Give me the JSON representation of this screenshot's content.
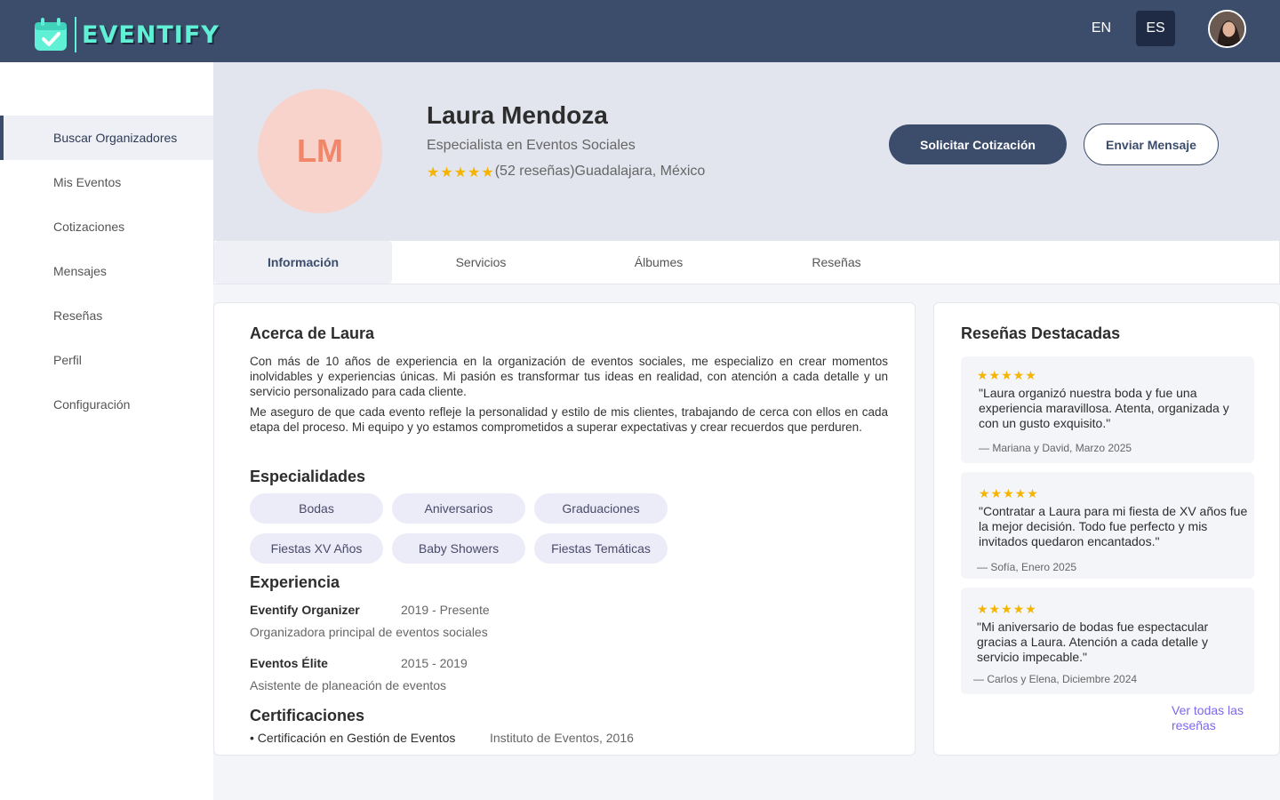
{
  "header": {
    "brand": "EVENTIFY",
    "lang_en": "EN",
    "lang_es": "ES",
    "active_lang": "ES"
  },
  "sidebar": {
    "items": [
      {
        "label": "Buscar Organizadores",
        "active": true
      },
      {
        "label": "Mis Eventos"
      },
      {
        "label": "Cotizaciones"
      },
      {
        "label": "Mensajes"
      },
      {
        "label": "Reseñas"
      },
      {
        "label": "Perfil"
      },
      {
        "label": "Configuración"
      }
    ]
  },
  "profile": {
    "initials": "LM",
    "name": "Laura Mendoza",
    "role": "Especialista en Eventos Sociales",
    "stars": "★★★★★",
    "rating": 5,
    "reviews_count": "(52 reseñas)",
    "location": "Guadalajara, México",
    "quote_button": "Solicitar Cotización",
    "message_button": "Enviar Mensaje"
  },
  "tabs": [
    "Información",
    "Servicios",
    "Álbumes",
    "Reseñas"
  ],
  "about": {
    "title": "Acerca de Laura",
    "p1": "Con más de 10 años de experiencia en la organización de eventos sociales, me especializo en crear momentos inolvidables y experiencias únicas. Mi pasión es transformar tus ideas en realidad, con atención a cada detalle y un servicio personalizado para cada cliente.",
    "p2": "Me aseguro de que cada evento refleje la personalidad y estilo de mis clientes, trabajando de cerca con ellos en cada etapa del proceso. Mi equipo y yo estamos comprometidos a superar expectativas y crear recuerdos que perduren."
  },
  "specialties": {
    "title": "Especialidades",
    "items": [
      "Bodas",
      "Aniversarios",
      "Graduaciones",
      "Fiestas XV Años",
      "Baby Showers",
      "Fiestas Temáticas"
    ]
  },
  "experience": {
    "title": "Experiencia",
    "items": [
      {
        "company": "Eventify Organizer",
        "years": "2019 - Presente",
        "desc": "Organizadora principal de eventos sociales"
      },
      {
        "company": "Eventos Élite",
        "years": "2015 - 2019",
        "desc": "Asistente de planeación de eventos"
      }
    ]
  },
  "certifications": {
    "title": "Certificaciones",
    "items": [
      {
        "name": "• Certificación en Gestión de Eventos",
        "source": "Instituto de Eventos, 2016"
      }
    ]
  },
  "reviews": {
    "title": "Reseñas Destacadas",
    "items": [
      {
        "stars": "★★★★★",
        "text": "\"Laura organizó nuestra boda y fue una experiencia maravillosa. Atenta, organizada y con un gusto exquisito.\"",
        "author": "— Mariana y David, Marzo 2025"
      },
      {
        "stars": "★★★★★",
        "text": "\"Contratar a Laura para mi fiesta de XV años fue la mejor decisión. Todo fue perfecto y mis invitados quedaron encantados.\"",
        "author": "— Sofía, Enero 2025"
      },
      {
        "stars": "★★★★★",
        "text": "\"Mi aniversario de bodas fue espectacular gracias a Laura. Atención a cada detalle y servicio impecable.\"",
        "author": "— Carlos y Elena, Diciembre 2024"
      }
    ],
    "see_all": "Ver todas las reseñas"
  },
  "colors": {
    "header_bg": "#3b4d6b",
    "brand_accent": "#5ff0d6",
    "star": "#f5b400",
    "link": "#7b68ee"
  }
}
